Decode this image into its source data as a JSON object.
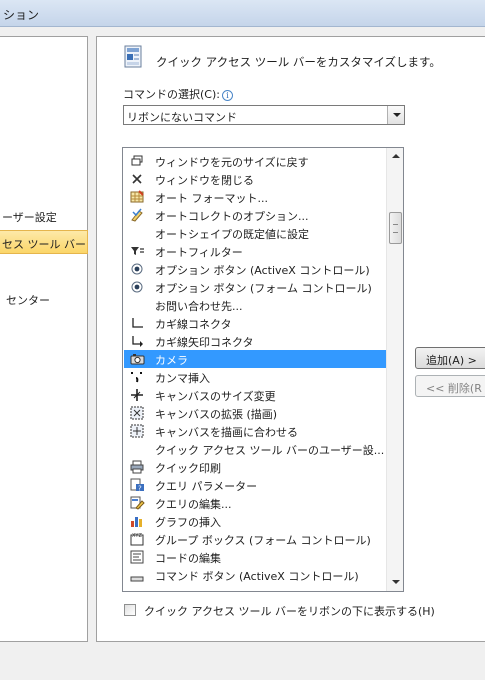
{
  "window": {
    "title_fragment": "ション"
  },
  "nav": {
    "items": [
      {
        "label": "ーザー設定"
      },
      {
        "label": "セス ツール バー"
      },
      {
        "label": "センター"
      }
    ]
  },
  "header": {
    "text": "クイック アクセス ツール バーをカスタマイズします。"
  },
  "command_select": {
    "label": "コマンドの選択(C):",
    "value": "リボンにないコマンド"
  },
  "commands": [
    {
      "label": "ウィンドウを元のサイズに戻す",
      "icon": "restore-window-icon"
    },
    {
      "label": "ウィンドウを閉じる",
      "icon": "close-window-icon"
    },
    {
      "label": "オート フォーマット...",
      "icon": "autoformat-icon"
    },
    {
      "label": "オートコレクトのオプション...",
      "icon": "autocorrect-icon"
    },
    {
      "label": "オートシェイプの既定値に設定",
      "icon": ""
    },
    {
      "label": "オートフィルター",
      "icon": "autofilter-icon"
    },
    {
      "label": "オプション ボタン (ActiveX コントロール)",
      "icon": "radio-button-icon"
    },
    {
      "label": "オプション ボタン (フォーム コントロール)",
      "icon": "radio-button-icon"
    },
    {
      "label": "お問い合わせ先...",
      "icon": ""
    },
    {
      "label": "カギ線コネクタ",
      "icon": "elbow-connector-icon"
    },
    {
      "label": "カギ線矢印コネクタ",
      "icon": "elbow-arrow-connector-icon"
    },
    {
      "label": "カメラ",
      "icon": "camera-icon"
    },
    {
      "label": "カンマ挿入",
      "icon": "comma-icon"
    },
    {
      "label": "キャンバスのサイズ変更",
      "icon": "canvas-resize-icon"
    },
    {
      "label": "キャンバスの拡張 (描画)",
      "icon": "canvas-expand-icon"
    },
    {
      "label": "キャンバスを描画に合わせる",
      "icon": "canvas-fit-icon"
    },
    {
      "label": "クイック アクセス ツール バーのユーザー設...",
      "icon": ""
    },
    {
      "label": "クイック印刷",
      "icon": "printer-icon"
    },
    {
      "label": "クエリ パラメーター",
      "icon": "query-parameter-icon"
    },
    {
      "label": "クエリの編集...",
      "icon": "edit-query-icon"
    },
    {
      "label": "グラフの挿入",
      "icon": "chart-icon"
    },
    {
      "label": "グループ ボックス (フォーム コントロール)",
      "icon": "group-box-icon"
    },
    {
      "label": "コードの編集",
      "icon": "edit-code-icon"
    },
    {
      "label": "コマンド ボタン (ActiveX コントロール)",
      "icon": "command-button-icon"
    }
  ],
  "buttons": {
    "add": "追加(A) >",
    "remove": "<< 削除(R"
  },
  "checkbox": {
    "label": "クイック アクセス ツール バーをリボンの下に表示する(H)"
  }
}
